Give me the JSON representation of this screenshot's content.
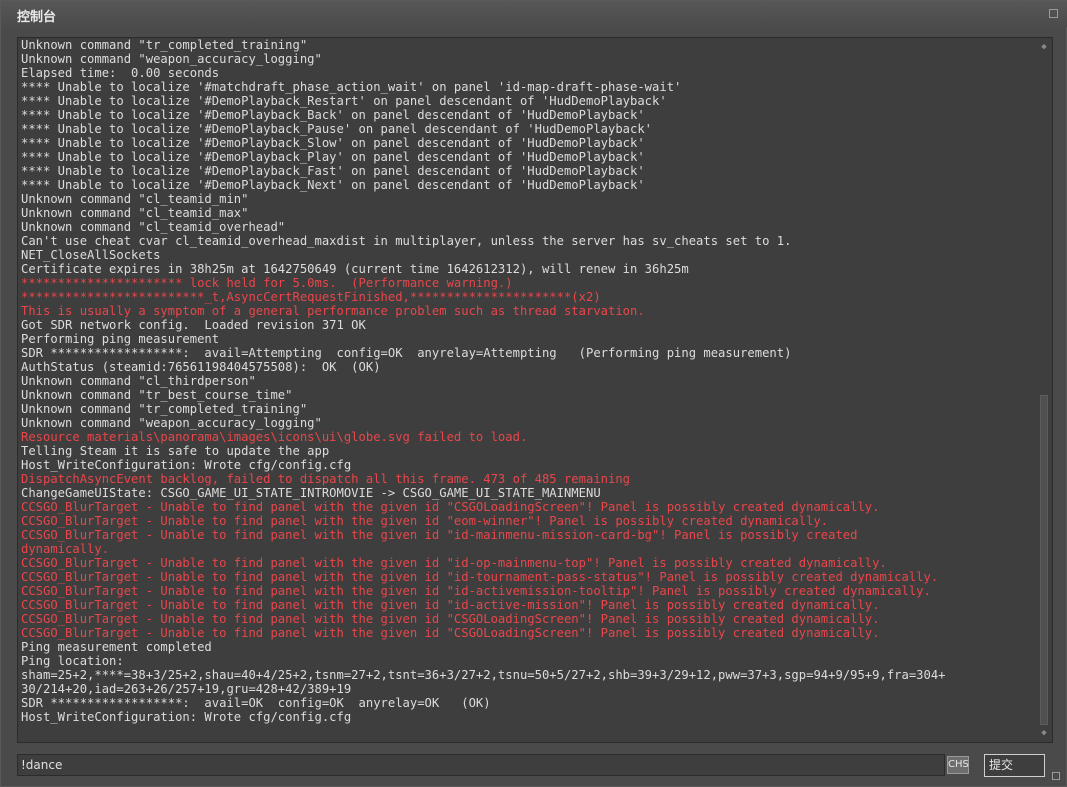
{
  "window": {
    "title": "控制台"
  },
  "log": {
    "lines": [
      {
        "t": "Unknown command \"tr_completed_training\"",
        "err": false
      },
      {
        "t": "Unknown command \"weapon_accuracy_logging\"",
        "err": false
      },
      {
        "t": "Elapsed time:  0.00 seconds",
        "err": false
      },
      {
        "t": "**** Unable to localize '#matchdraft_phase_action_wait' on panel 'id-map-draft-phase-wait'",
        "err": false
      },
      {
        "t": "**** Unable to localize '#DemoPlayback_Restart' on panel descendant of 'HudDemoPlayback'",
        "err": false
      },
      {
        "t": "**** Unable to localize '#DemoPlayback_Back' on panel descendant of 'HudDemoPlayback'",
        "err": false
      },
      {
        "t": "**** Unable to localize '#DemoPlayback_Pause' on panel descendant of 'HudDemoPlayback'",
        "err": false
      },
      {
        "t": "**** Unable to localize '#DemoPlayback_Slow' on panel descendant of 'HudDemoPlayback'",
        "err": false
      },
      {
        "t": "**** Unable to localize '#DemoPlayback_Play' on panel descendant of 'HudDemoPlayback'",
        "err": false
      },
      {
        "t": "**** Unable to localize '#DemoPlayback_Fast' on panel descendant of 'HudDemoPlayback'",
        "err": false
      },
      {
        "t": "**** Unable to localize '#DemoPlayback_Next' on panel descendant of 'HudDemoPlayback'",
        "err": false
      },
      {
        "t": "Unknown command \"cl_teamid_min\"",
        "err": false
      },
      {
        "t": "Unknown command \"cl_teamid_max\"",
        "err": false
      },
      {
        "t": "Unknown command \"cl_teamid_overhead\"",
        "err": false
      },
      {
        "t": "Can't use cheat cvar cl_teamid_overhead_maxdist in multiplayer, unless the server has sv_cheats set to 1.",
        "err": false
      },
      {
        "t": "NET_CloseAllSockets",
        "err": false
      },
      {
        "t": "Certificate expires in 38h25m at 1642750649 (current time 1642612312), will renew in 36h25m",
        "err": false
      },
      {
        "t": "********************** lock held for 5.0ms.  (Performance warning.)",
        "err": true
      },
      {
        "t": "*************************_t,AsyncCertRequestFinished,**********************(x2)",
        "err": true
      },
      {
        "t": "This is usually a symptom of a general performance problem such as thread starvation.",
        "err": true
      },
      {
        "t": "Got SDR network config.  Loaded revision 371 OK",
        "err": false
      },
      {
        "t": "Performing ping measurement",
        "err": false
      },
      {
        "t": "SDR ******************:  avail=Attempting  config=OK  anyrelay=Attempting   (Performing ping measurement)",
        "err": false
      },
      {
        "t": "AuthStatus (steamid:76561198404575508):  OK  (OK)",
        "err": false
      },
      {
        "t": "Unknown command \"cl_thirdperson\"",
        "err": false
      },
      {
        "t": "Unknown command \"tr_best_course_time\"",
        "err": false
      },
      {
        "t": "Unknown command \"tr_completed_training\"",
        "err": false
      },
      {
        "t": "Unknown command \"weapon_accuracy_logging\"",
        "err": false
      },
      {
        "t": "Resource materials\\panorama\\images\\icons\\ui\\globe.svg failed to load.",
        "err": true
      },
      {
        "t": "Telling Steam it is safe to update the app",
        "err": false
      },
      {
        "t": "Host_WriteConfiguration: Wrote cfg/config.cfg",
        "err": false
      },
      {
        "t": "DispatchAsyncEvent backlog, failed to dispatch all this frame. 473 of 485 remaining",
        "err": true
      },
      {
        "t": "ChangeGameUIState: CSGO_GAME_UI_STATE_INTROMOVIE -> CSGO_GAME_UI_STATE_MAINMENU",
        "err": false
      },
      {
        "t": "CCSGO_BlurTarget - Unable to find panel with the given id \"CSGOLoadingScreen\"! Panel is possibly created dynamically.",
        "err": true
      },
      {
        "t": "CCSGO_BlurTarget - Unable to find panel with the given id \"eom-winner\"! Panel is possibly created dynamically.",
        "err": true
      },
      {
        "t": "CCSGO_BlurTarget - Unable to find panel with the given id \"id-mainmenu-mission-card-bg\"! Panel is possibly created",
        "err": true
      },
      {
        "t": "dynamically.",
        "err": true
      },
      {
        "t": "CCSGO_BlurTarget - Unable to find panel with the given id \"id-op-mainmenu-top\"! Panel is possibly created dynamically.",
        "err": true
      },
      {
        "t": "CCSGO_BlurTarget - Unable to find panel with the given id \"id-tournament-pass-status\"! Panel is possibly created dynamically.",
        "err": true
      },
      {
        "t": "CCSGO_BlurTarget - Unable to find panel with the given id \"id-activemission-tooltip\"! Panel is possibly created dynamically.",
        "err": true
      },
      {
        "t": "CCSGO_BlurTarget - Unable to find panel with the given id \"id-active-mission\"! Panel is possibly created dynamically.",
        "err": true
      },
      {
        "t": "CCSGO_BlurTarget - Unable to find panel with the given id \"CSGOLoadingScreen\"! Panel is possibly created dynamically.",
        "err": true
      },
      {
        "t": "CCSGO_BlurTarget - Unable to find panel with the given id \"CSGOLoadingScreen\"! Panel is possibly created dynamically.",
        "err": true
      },
      {
        "t": "Ping measurement completed",
        "err": false
      },
      {
        "t": "Ping location:",
        "err": false
      },
      {
        "t": "sham=25+2,****=38+3/25+2,shau=40+4/25+2,tsnm=27+2,tsnt=36+3/27+2,tsnu=50+5/27+2,shb=39+3/29+12,pww=37+3,sgp=94+9/95+9,fra=304+",
        "err": false
      },
      {
        "t": "30/214+20,iad=263+26/257+19,gru=428+42/389+19",
        "err": false
      },
      {
        "t": "SDR ******************:  avail=OK  config=OK  anyrelay=OK   (OK)",
        "err": false
      },
      {
        "t": "Host_WriteConfiguration: Wrote cfg/config.cfg",
        "err": false
      }
    ]
  },
  "input": {
    "value": "!dance"
  },
  "ime": {
    "label": "CHS"
  },
  "submit": {
    "label": "提交"
  },
  "colors": {
    "normal": "#dcdcdc",
    "error": "#e8464a",
    "background": "#3e3e3e"
  }
}
